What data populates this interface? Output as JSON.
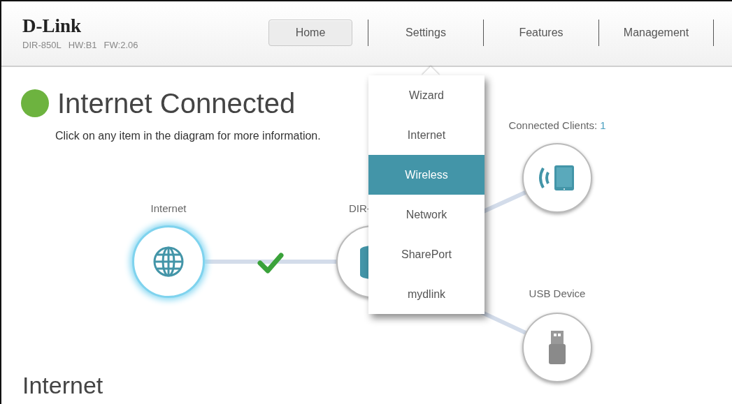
{
  "header": {
    "logo": "D-Link",
    "model": "DIR-850L",
    "hw": "HW:B1",
    "fw": "FW:2.06"
  },
  "nav": [
    {
      "label": "Home",
      "selected": true
    },
    {
      "label": "Settings",
      "selected": false
    },
    {
      "label": "Features",
      "selected": false
    },
    {
      "label": "Management",
      "selected": false
    }
  ],
  "dropdown": {
    "items": [
      {
        "label": "Wizard",
        "selected": false
      },
      {
        "label": "Internet",
        "selected": false
      },
      {
        "label": "Wireless",
        "selected": true
      },
      {
        "label": "Network",
        "selected": false
      },
      {
        "label": "SharePort",
        "selected": false
      },
      {
        "label": "mydlink",
        "selected": false
      }
    ]
  },
  "status": {
    "title": "Internet Connected",
    "connected": true,
    "hint": "Click on any item in the diagram for more information."
  },
  "diagram": {
    "link_ok": true,
    "nodes": [
      {
        "kind": "internet",
        "label": "Internet",
        "highlighted": true
      },
      {
        "kind": "router",
        "label": "DIR-",
        "highlighted": false
      },
      {
        "kind": "clients",
        "label": "Connected Clients:",
        "count": "1",
        "highlighted": false
      },
      {
        "kind": "usb",
        "label": "USB Device",
        "highlighted": false
      }
    ]
  },
  "section_title": "Internet"
}
